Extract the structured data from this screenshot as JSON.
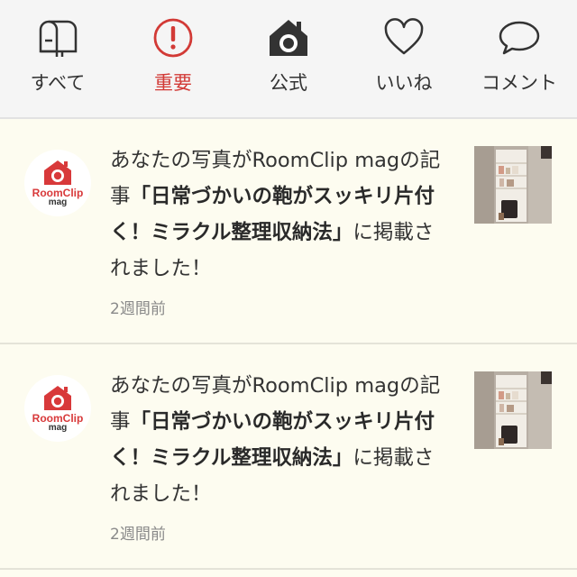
{
  "tabs": [
    {
      "label": "すべて",
      "icon": "mailbox-icon",
      "active": false
    },
    {
      "label": "重要",
      "icon": "alert-icon",
      "active": true
    },
    {
      "label": "公式",
      "icon": "camera-house-icon",
      "active": false
    },
    {
      "label": "いいね",
      "icon": "heart-icon",
      "active": false
    },
    {
      "label": "コメント",
      "icon": "speech-bubble-icon",
      "active": false
    }
  ],
  "colors": {
    "accent": "#d23a36",
    "background": "#fdfcf0",
    "tabbar": "#f5f5f5"
  },
  "notifications": [
    {
      "avatar": {
        "brand": "RoomClip",
        "brand_sub": "mag"
      },
      "prefix": "あなたの写真がRoomClip magの記事",
      "title": "「日常づかいの鞄がスッキリ片付く！ミラクル整理収納法」",
      "suffix": "に掲載されました！",
      "time": "2週間前"
    },
    {
      "avatar": {
        "brand": "RoomClip",
        "brand_sub": "mag"
      },
      "prefix": "あなたの写真がRoomClip magの記事",
      "title": "「日常づかいの鞄がスッキリ片付く！ミラクル整理収納法」",
      "suffix": "に掲載されました！",
      "time": "2週間前"
    }
  ]
}
